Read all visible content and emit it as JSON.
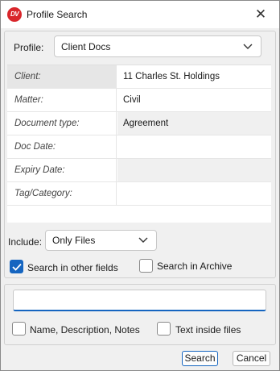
{
  "window": {
    "title": "Profile Search",
    "logo_text": "DV"
  },
  "profile": {
    "label": "Profile:",
    "selected": "Client Docs"
  },
  "fields": [
    {
      "label": "Client:",
      "value": "11 Charles St. Holdings"
    },
    {
      "label": "Matter:",
      "value": "Civil"
    },
    {
      "label": "Document type:",
      "value": "Agreement"
    },
    {
      "label": "Doc Date:",
      "value": ""
    },
    {
      "label": "Expiry Date:",
      "value": ""
    },
    {
      "label": "Tag/Category:",
      "value": ""
    }
  ],
  "include": {
    "label": "Include:",
    "selected": "Only Files"
  },
  "options": {
    "search_other_fields": {
      "label": "Search in other fields",
      "checked": true
    },
    "search_archive": {
      "label": "Search in Archive",
      "checked": false
    }
  },
  "fulltext": {
    "query": "",
    "name_desc_notes": {
      "label": "Name, Description, Notes",
      "checked": false
    },
    "text_inside_files": {
      "label": "Text inside files",
      "checked": false
    }
  },
  "buttons": {
    "search": "Search",
    "cancel": "Cancel"
  },
  "colors": {
    "accent": "#1565c0",
    "logo": "#d9262b"
  }
}
